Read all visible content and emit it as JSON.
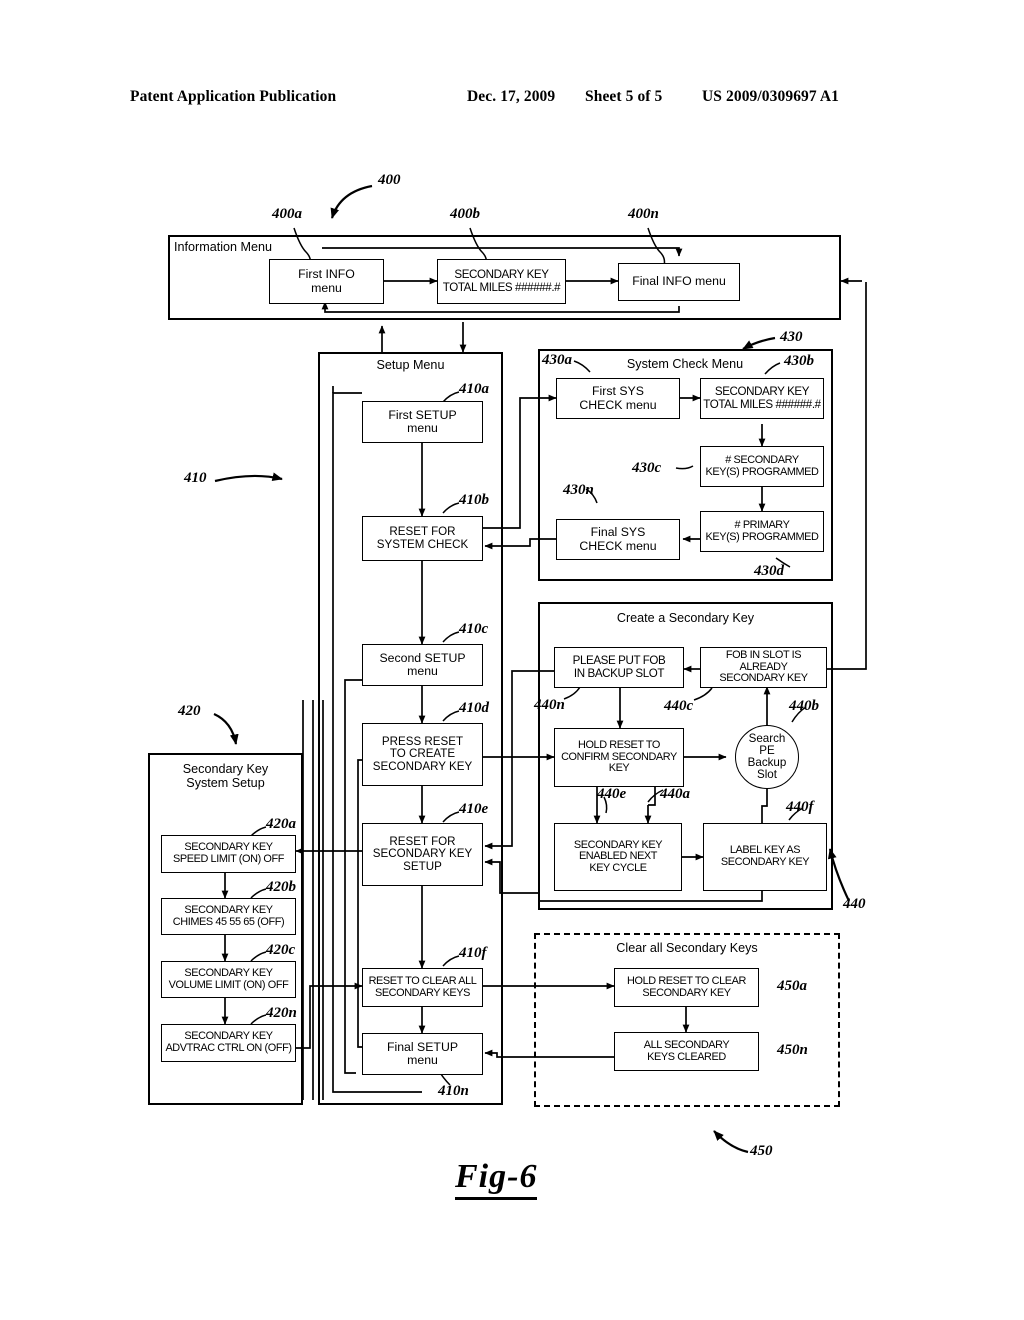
{
  "header": {
    "publication": "Patent Application Publication",
    "date": "Dec. 17, 2009",
    "sheet": "Sheet 5 of 5",
    "number": "US 2009/0309697 A1"
  },
  "figure": {
    "caption": "Fig-6"
  },
  "groups": {
    "information_menu": {
      "title": "Information Menu",
      "ref": "400"
    },
    "setup_menu": {
      "title": "Setup Menu",
      "ref": "410"
    },
    "secondary_key_system_setup": {
      "title": "Secondary Key\nSystem Setup",
      "ref": "420"
    },
    "system_check_menu": {
      "title": "System Check Menu",
      "ref": "430"
    },
    "create_secondary_key": {
      "title": "Create a Secondary Key",
      "ref": "440"
    },
    "clear_all_secondary_keys": {
      "title": "Clear all Secondary Keys",
      "ref": "450"
    }
  },
  "nodes": {
    "n400a": {
      "label": "First INFO\nmenu",
      "ref": "400a"
    },
    "n400b": {
      "label": "SECONDARY KEY\nTOTAL MILES ######.#",
      "ref": "400b"
    },
    "n400n": {
      "label": "Final INFO menu",
      "ref": "400n"
    },
    "n410a": {
      "label": "First SETUP\nmenu",
      "ref": "410a"
    },
    "n410b": {
      "label": "RESET FOR\nSYSTEM CHECK",
      "ref": "410b"
    },
    "n410c": {
      "label": "Second SETUP\nmenu",
      "ref": "410c"
    },
    "n410d": {
      "label": "PRESS RESET\nTO CREATE\nSECONDARY KEY",
      "ref": "410d"
    },
    "n410e": {
      "label": "RESET FOR\nSECONDARY KEY\nSETUP",
      "ref": "410e"
    },
    "n410f": {
      "label": "RESET TO CLEAR ALL\nSECONDARY KEYS",
      "ref": "410f"
    },
    "n410n": {
      "label": "Final SETUP\nmenu",
      "ref": "410n"
    },
    "n420a": {
      "label": "SECONDARY KEY\nSPEED LIMIT (ON) OFF",
      "ref": "420a"
    },
    "n420b": {
      "label": "SECONDARY KEY\nCHIMES 45 55 65 (OFF)",
      "ref": "420b"
    },
    "n420c": {
      "label": "SECONDARY KEY\nVOLUME LIMIT (ON) OFF",
      "ref": "420c"
    },
    "n420n": {
      "label": "SECONDARY KEY\nADVTRAC CTRL ON (OFF)",
      "ref": "420n"
    },
    "n430a": {
      "label": "First SYS\nCHECK menu",
      "ref": "430a"
    },
    "n430b": {
      "label": "SECONDARY KEY\nTOTAL MILES ######.#",
      "ref": "430b"
    },
    "n430c": {
      "label": "# SECONDARY\nKEY(S) PROGRAMMED",
      "ref": "430c"
    },
    "n430d": {
      "label": "# PRIMARY\nKEY(S) PROGRAMMED",
      "ref": "430d"
    },
    "n430n": {
      "label": "Final SYS\nCHECK menu",
      "ref": "430n"
    },
    "n440n": {
      "label": "PLEASE PUT FOB\nIN BACKUP SLOT",
      "ref": "440n"
    },
    "n440c": {
      "label": "FOB IN SLOT IS ALREADY\nSECONDARY KEY",
      "ref": "440c"
    },
    "n440a": {
      "label": "HOLD RESET TO\nCONFIRM SECONDARY\nKEY",
      "ref": "440a"
    },
    "n440b": {
      "label": "Search\nPE\nBackup\nSlot",
      "ref": "440b"
    },
    "n440e": {
      "label": "SECONDARY KEY\nENABLED NEXT\nKEY CYCLE",
      "ref": "440e"
    },
    "n440f": {
      "label": "LABEL KEY AS\nSECONDARY KEY",
      "ref": "440f"
    },
    "n450a": {
      "label": "HOLD RESET TO CLEAR\nSECONDARY KEY",
      "ref": "450a"
    },
    "n450n": {
      "label": "ALL SECONDARY\nKEYS CLEARED",
      "ref": "450n"
    }
  },
  "colors": {
    "ink": "#000000",
    "paper": "#ffffff"
  }
}
